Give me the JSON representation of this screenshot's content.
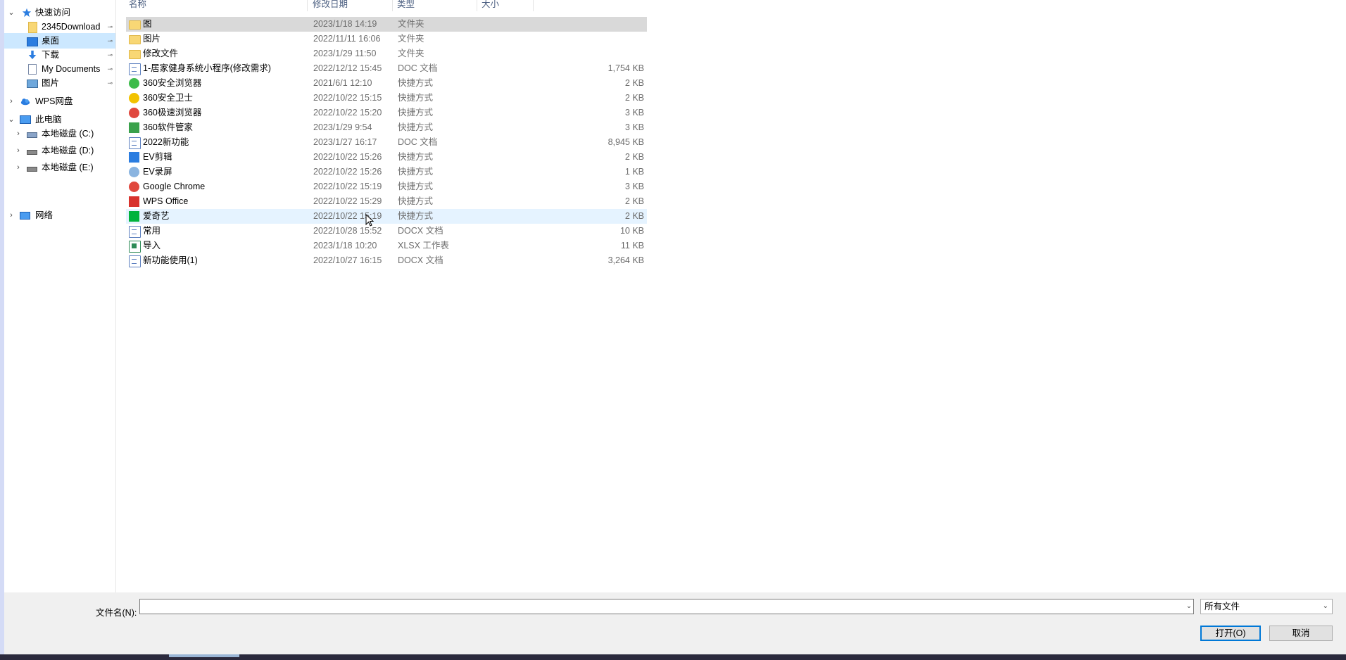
{
  "nav": {
    "quick_access": "快速访问",
    "items": [
      {
        "label": "2345Download",
        "pinned": true
      },
      {
        "label": "桌面",
        "pinned": true,
        "selected": true
      },
      {
        "label": "下载",
        "pinned": true
      },
      {
        "label": "My Documents",
        "pinned": true
      },
      {
        "label": "图片",
        "pinned": true
      }
    ],
    "wps_cloud": "WPS网盘",
    "this_pc": "此电脑",
    "drives": [
      "本地磁盘 (C:)",
      "本地磁盘 (D:)",
      "本地磁盘 (E:)"
    ],
    "network": "网络",
    "pin_glyph": "📌"
  },
  "list": {
    "headers": {
      "name": "名称",
      "date": "修改日期",
      "type": "类型",
      "size": "大小"
    },
    "rows": [
      {
        "name": "图",
        "date": "2023/1/18 14:19",
        "type": "文件夹",
        "size": "",
        "icon": "folder-icon",
        "state": "selected"
      },
      {
        "name": "图片",
        "date": "2022/11/11 16:06",
        "type": "文件夹",
        "size": "",
        "icon": "folder-icon"
      },
      {
        "name": "修改文件",
        "date": "2023/1/29 11:50",
        "type": "文件夹",
        "size": "",
        "icon": "folder-icon"
      },
      {
        "name": "1-居家健身系统小程序(修改需求)",
        "date": "2022/12/12 15:45",
        "type": "DOC 文档",
        "size": "1,754 KB",
        "icon": "doc-icon"
      },
      {
        "name": "360安全浏览器",
        "date": "2021/6/1 12:10",
        "type": "快捷方式",
        "size": "2 KB",
        "icon": "360-browser-icon"
      },
      {
        "name": "360安全卫士",
        "date": "2022/10/22 15:15",
        "type": "快捷方式",
        "size": "2 KB",
        "icon": "360-security-icon"
      },
      {
        "name": "360极速浏览器",
        "date": "2022/10/22 15:20",
        "type": "快捷方式",
        "size": "3 KB",
        "icon": "360-speed-browser-icon"
      },
      {
        "name": "360软件管家",
        "date": "2023/1/29 9:54",
        "type": "快捷方式",
        "size": "3 KB",
        "icon": "360-software-manager-icon"
      },
      {
        "name": "2022新功能",
        "date": "2023/1/27 16:17",
        "type": "DOC 文档",
        "size": "8,945 KB",
        "icon": "doc-icon"
      },
      {
        "name": "EV剪辑",
        "date": "2022/10/22 15:26",
        "type": "快捷方式",
        "size": "2 KB",
        "icon": "ev-edit-icon"
      },
      {
        "name": "EV录屏",
        "date": "2022/10/22 15:26",
        "type": "快捷方式",
        "size": "1 KB",
        "icon": "ev-record-icon"
      },
      {
        "name": "Google Chrome",
        "date": "2022/10/22 15:19",
        "type": "快捷方式",
        "size": "3 KB",
        "icon": "chrome-icon"
      },
      {
        "name": "WPS Office",
        "date": "2022/10/22 15:29",
        "type": "快捷方式",
        "size": "2 KB",
        "icon": "wps-icon"
      },
      {
        "name": "爱奇艺",
        "date": "2022/10/22 15:19",
        "type": "快捷方式",
        "size": "2 KB",
        "icon": "iqiyi-icon",
        "state": "hover"
      },
      {
        "name": "常用",
        "date": "2022/10/28 15:52",
        "type": "DOCX 文档",
        "size": "10 KB",
        "icon": "docx-icon"
      },
      {
        "name": "导入",
        "date": "2023/1/18 10:20",
        "type": "XLSX 工作表",
        "size": "11 KB",
        "icon": "xlsx-icon"
      },
      {
        "name": "新功能使用(1)",
        "date": "2022/10/27 16:15",
        "type": "DOCX 文档",
        "size": "3,264 KB",
        "icon": "docx-icon"
      }
    ]
  },
  "bottom": {
    "filename_label": "文件名(N):",
    "filename_value": "",
    "file_type": "所有文件",
    "open_label": "打开(O)",
    "cancel_label": "取消"
  },
  "colors": {
    "accent": "#0078d7",
    "selected_nav": "#cce8ff",
    "selected_row": "#d9d9d9",
    "hover_row": "#e5f3ff"
  }
}
